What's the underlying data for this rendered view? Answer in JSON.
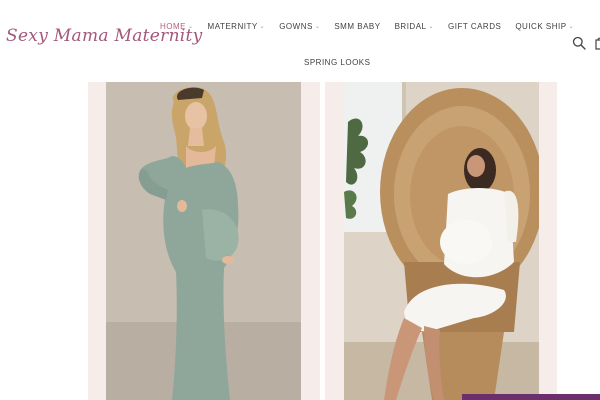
{
  "brand": {
    "logo_text": "Sexy Mama Maternity"
  },
  "nav": {
    "items": [
      {
        "label": "HOME",
        "chevron": true,
        "active": true
      },
      {
        "label": "MATERNITY",
        "chevron": true,
        "active": false
      },
      {
        "label": "GOWNS",
        "chevron": true,
        "active": false
      },
      {
        "label": "SMM BABY",
        "chevron": false,
        "active": false
      },
      {
        "label": "BRIDAL",
        "chevron": true,
        "active": false
      },
      {
        "label": "GIFT CARDS",
        "chevron": false,
        "active": false
      },
      {
        "label": "QUICK SHIP",
        "chevron": true,
        "active": false
      }
    ],
    "row2_label": "SPRING LOOKS"
  },
  "icons": {
    "search": "search-icon",
    "cart": "cart-icon",
    "chevron": "chevron-down-icon"
  },
  "products": [
    {
      "image": "sage-green-maternity-gown-photo",
      "dress_color": "#8fa79a"
    },
    {
      "image": "white-maternity-dress-on-wicker-chair-photo",
      "dress_color": "#f7f5f1"
    }
  ],
  "colors": {
    "brand": "#a3577a",
    "nav_active": "#b4607c",
    "nav_text": "#3f3f3f",
    "frame_bg": "#f6ece9",
    "badge": "#6a2f6c"
  }
}
